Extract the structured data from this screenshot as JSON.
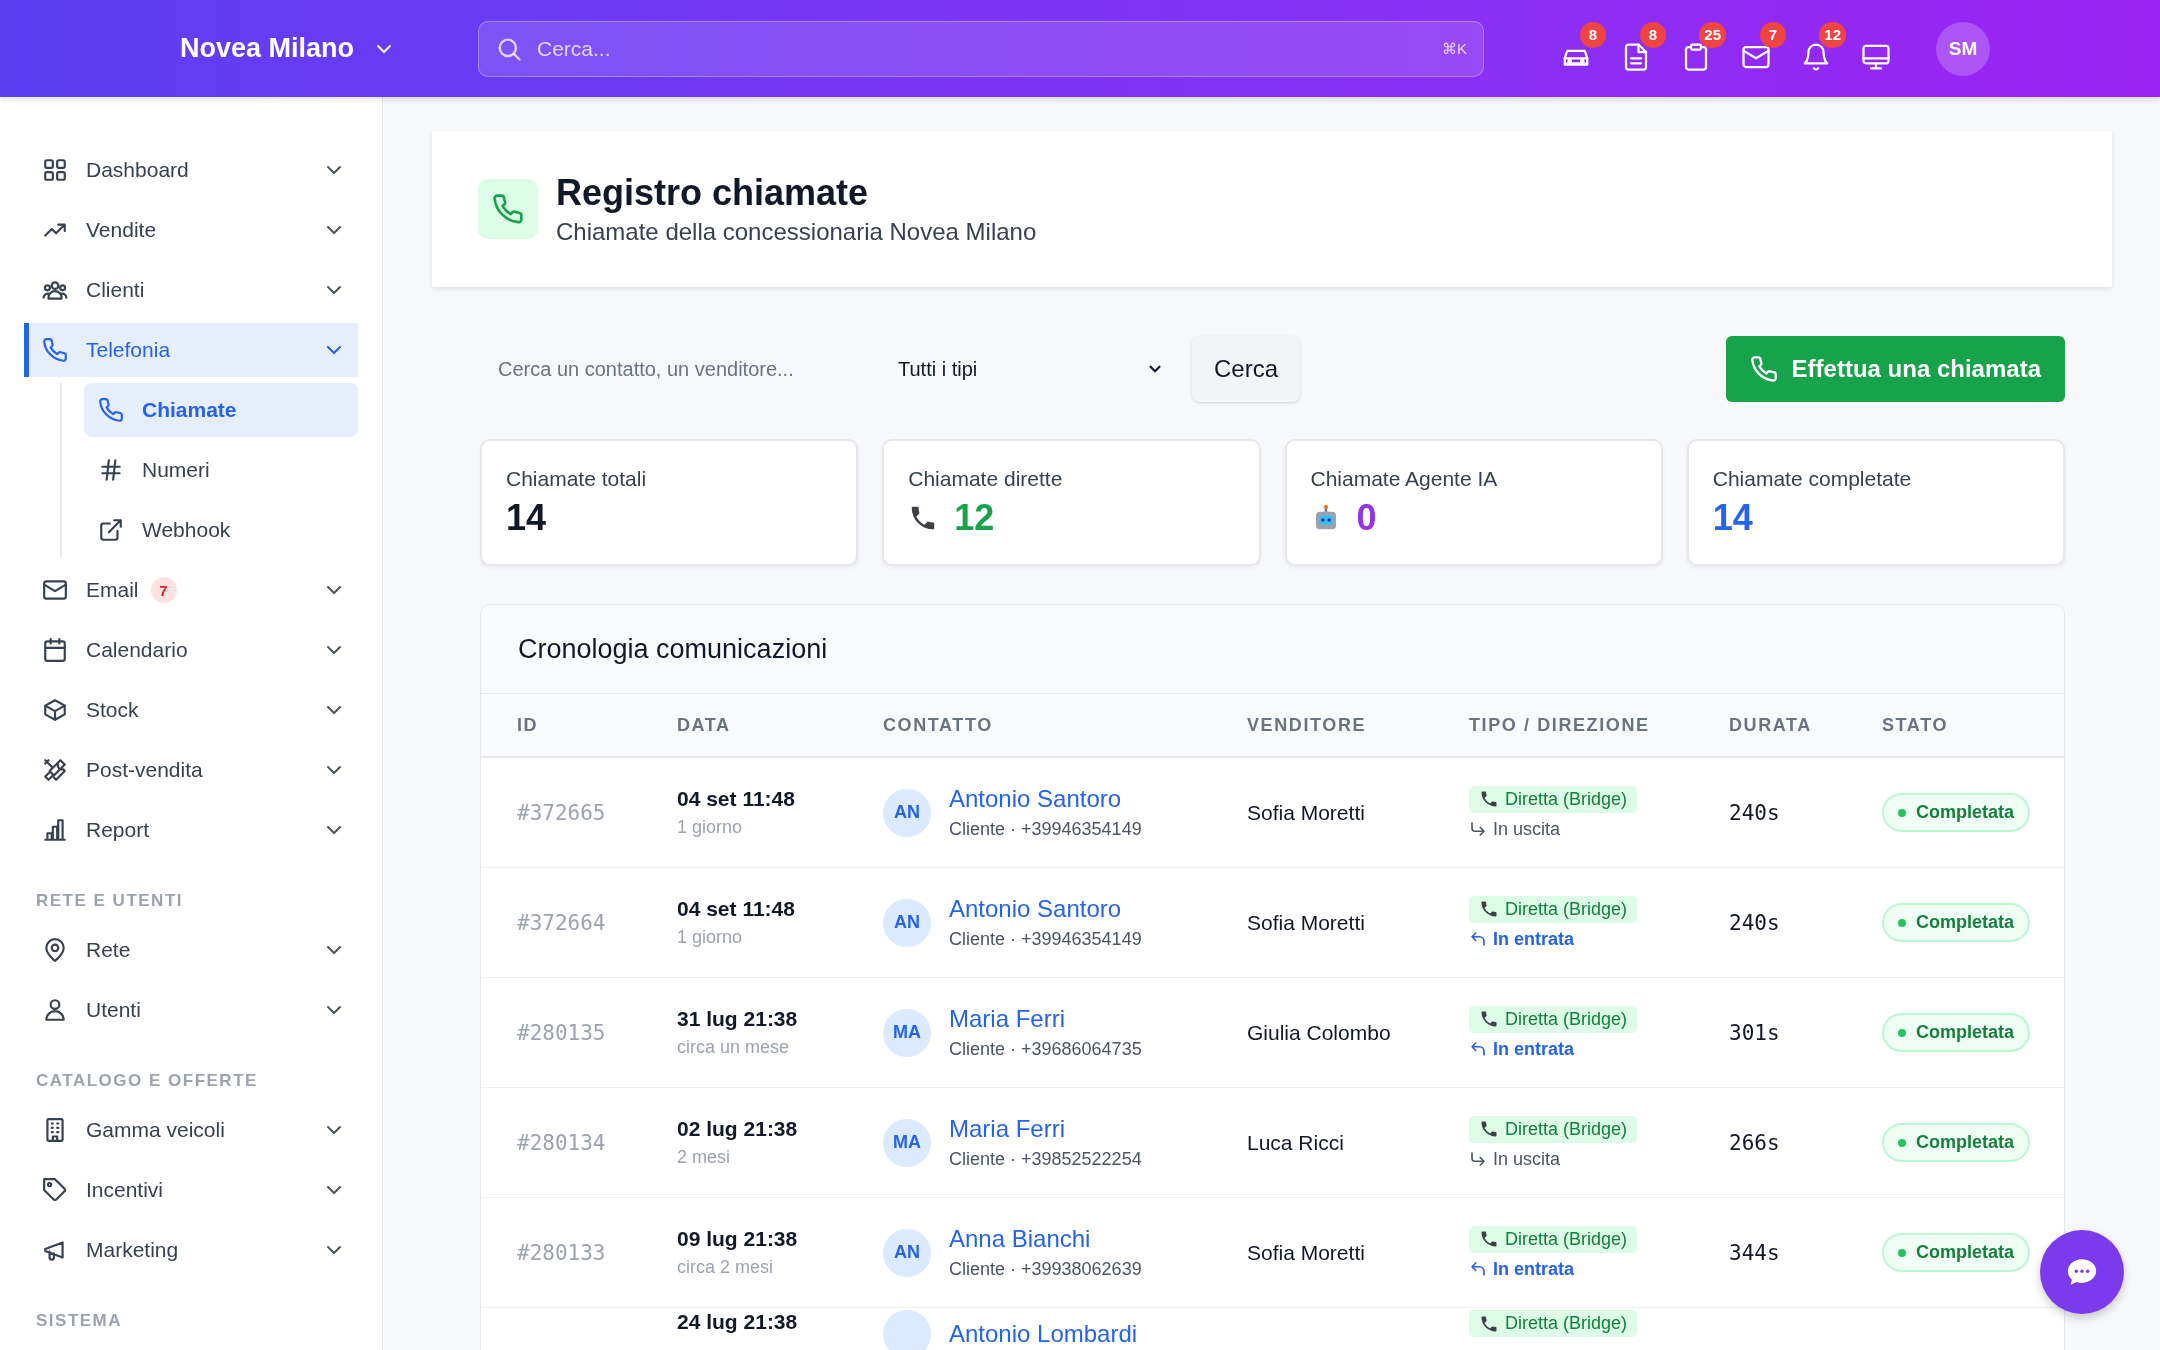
{
  "header": {
    "brand": "Novea Milano",
    "search": {
      "placeholder": "Cerca...",
      "shortcut": "⌘K"
    },
    "badges": [
      "8",
      "8",
      "25",
      "7",
      "12"
    ],
    "avatar": "SM"
  },
  "sidebar": {
    "sections": [
      {
        "items": [
          {
            "label": "Dashboard",
            "selected": false
          },
          {
            "label": "Vendite",
            "selected": false
          },
          {
            "label": "Clienti",
            "selected": false
          },
          {
            "label": "Telefonia",
            "selected": true,
            "children": [
              {
                "label": "Chiamate",
                "selected": true
              },
              {
                "label": "Numeri",
                "selected": false
              },
              {
                "label": "Webhook",
                "selected": false
              }
            ]
          },
          {
            "label": "Email",
            "selected": false,
            "badge": "7"
          },
          {
            "label": "Calendario",
            "selected": false
          },
          {
            "label": "Stock",
            "selected": false
          },
          {
            "label": "Post-vendita",
            "selected": false
          },
          {
            "label": "Report",
            "selected": false
          }
        ]
      },
      {
        "heading": "RETE E UTENTI",
        "items": [
          {
            "label": "Rete",
            "selected": false
          },
          {
            "label": "Utenti",
            "selected": false
          }
        ]
      },
      {
        "heading": "CATALOGO E OFFERTE",
        "items": [
          {
            "label": "Gamma veicoli",
            "selected": false
          },
          {
            "label": "Incentivi",
            "selected": false
          },
          {
            "label": "Marketing",
            "selected": false
          }
        ]
      },
      {
        "heading": "SISTEMA"
      }
    ]
  },
  "page": {
    "title": "Registro chiamate",
    "subtitle": "Chiamate della concessionaria Novea Milano"
  },
  "filters": {
    "search": {
      "placeholder": "Cerca un contatto, un venditore..."
    },
    "type_select": "Tutti i tipi",
    "search_button": "Cerca",
    "call_button": "Effettua una chiamata"
  },
  "stats": [
    {
      "kind": "total",
      "label": "Chiamate totali",
      "value": "14"
    },
    {
      "kind": "direct",
      "label": "Chiamate dirette",
      "value": "12"
    },
    {
      "kind": "ai",
      "label": "Chiamate Agente IA",
      "value": "0"
    },
    {
      "kind": "completed",
      "label": "Chiamate completate",
      "value": "14"
    }
  ],
  "table": {
    "title": "Cronologia comunicazioni",
    "columns": [
      "ID",
      "DATA",
      "CONTATTO",
      "VENDITORE",
      "TIPO / DIREZIONE",
      "DURATA",
      "STATO"
    ],
    "rows": [
      {
        "id": "#372665",
        "date": "04 set 11:48",
        "ago": "1 giorno",
        "initials": "AN",
        "name": "Antonio Santoro",
        "detail": "Cliente · +39946354149",
        "seller": "Sofia Moretti",
        "type": "Diretta (Bridge)",
        "direction": {
          "kind": "outgoing",
          "label": "In uscita"
        },
        "duration": "240s",
        "status": "Completata"
      },
      {
        "id": "#372664",
        "date": "04 set 11:48",
        "ago": "1 giorno",
        "initials": "AN",
        "name": "Antonio Santoro",
        "detail": "Cliente · +39946354149",
        "seller": "Sofia Moretti",
        "type": "Diretta (Bridge)",
        "direction": {
          "kind": "incoming",
          "label": "In entrata"
        },
        "duration": "240s",
        "status": "Completata"
      },
      {
        "id": "#280135",
        "date": "31 lug 21:38",
        "ago": "circa un mese",
        "initials": "MA",
        "name": "Maria Ferri",
        "detail": "Cliente · +39686064735",
        "seller": "Giulia Colombo",
        "type": "Diretta (Bridge)",
        "direction": {
          "kind": "incoming",
          "label": "In entrata"
        },
        "duration": "301s",
        "status": "Completata"
      },
      {
        "id": "#280134",
        "date": "02 lug 21:38",
        "ago": "2 mesi",
        "initials": "MA",
        "name": "Maria Ferri",
        "detail": "Cliente · +39852522254",
        "seller": "Luca Ricci",
        "type": "Diretta (Bridge)",
        "direction": {
          "kind": "outgoing",
          "label": "In uscita"
        },
        "duration": "266s",
        "status": "Completata"
      },
      {
        "id": "#280133",
        "date": "09 lug 21:38",
        "ago": "circa 2 mesi",
        "initials": "AN",
        "name": "Anna Bianchi",
        "detail": "Cliente · +39938062639",
        "seller": "Sofia Moretti",
        "type": "Diretta (Bridge)",
        "direction": {
          "kind": "incoming",
          "label": "In entrata"
        },
        "duration": "344s",
        "status": "Completata"
      },
      {
        "date": "24 lug 21:38",
        "name": "Antonio Lombardi",
        "type": "Diretta (Bridge)"
      }
    ]
  }
}
